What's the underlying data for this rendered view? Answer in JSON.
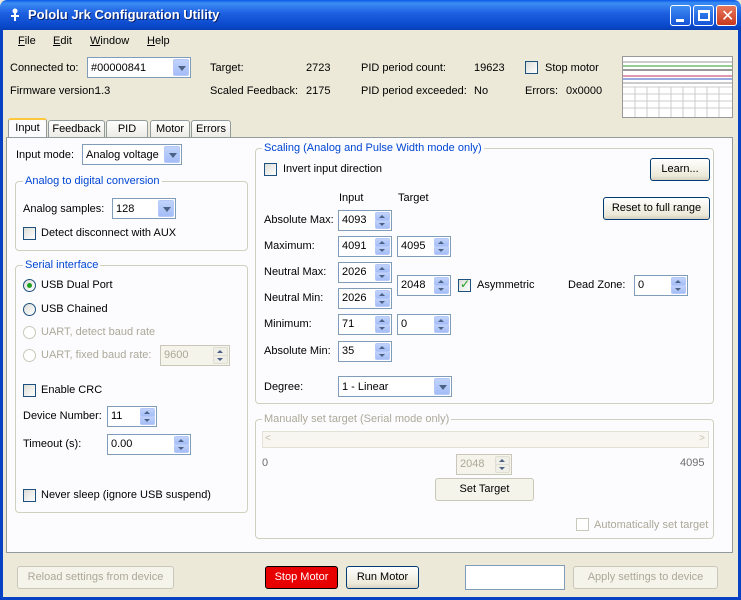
{
  "window": {
    "title": "Pololu Jrk Configuration Utility"
  },
  "menu": [
    {
      "label": "File",
      "key": "F",
      "rest": "ile"
    },
    {
      "label": "Edit",
      "key": "E",
      "rest": "dit"
    },
    {
      "label": "Window",
      "key": "W",
      "rest": "indow"
    },
    {
      "label": "Help",
      "key": "H",
      "rest": "elp"
    }
  ],
  "status": {
    "connected_label": "Connected to:",
    "device": "#00000841",
    "firmware_label": "Firmware version:",
    "firmware": "1.3",
    "target_label": "Target:",
    "target": "2723",
    "scaled_feedback_label": "Scaled Feedback:",
    "scaled_feedback": "2175",
    "pid_count_label": "PID period count:",
    "pid_count": "19623",
    "pid_exceeded_label": "PID period exceeded:",
    "pid_exceeded": "No",
    "stop_motor_label": "Stop motor",
    "errors_label": "Errors:",
    "errors": "0x0000"
  },
  "tabs": [
    "Input",
    "Feedback",
    "PID",
    "Motor",
    "Errors"
  ],
  "input": {
    "mode_label": "Input mode:",
    "mode_value": "Analog voltage",
    "adc_group": "Analog to digital conversion",
    "analog_samples_label": "Analog samples:",
    "analog_samples_value": "128",
    "detect_disconnect_label": "Detect disconnect with AUX",
    "serial_group": "Serial interface",
    "usb_dual": "USB Dual Port",
    "usb_chained": "USB Chained",
    "uart_detect": "UART, detect baud rate",
    "uart_fixed": "UART, fixed baud rate:",
    "baud_value": "9600",
    "enable_crc": "Enable CRC",
    "device_number_label": "Device Number:",
    "device_number": "11",
    "timeout_label": "Timeout (s):",
    "timeout": "0.00",
    "never_sleep": "Never sleep (ignore USB suspend)"
  },
  "scaling": {
    "group": "Scaling (Analog and Pulse Width mode only)",
    "invert_label": "Invert input direction",
    "learn_button": "Learn...",
    "reset_button": "Reset to full range",
    "input_header": "Input",
    "target_header": "Target",
    "abs_max_label": "Absolute Max:",
    "abs_max": "4093",
    "max_label": "Maximum:",
    "max_input": "4091",
    "max_target": "4095",
    "neutral_max_label": "Neutral Max:",
    "neutral_max": "2026",
    "neutral_target": "2048",
    "asymmetric_label": "Asymmetric",
    "dead_zone_label": "Dead Zone:",
    "dead_zone": "0",
    "neutral_min_label": "Neutral Min:",
    "neutral_min": "2026",
    "min_label": "Minimum:",
    "min_input": "71",
    "min_target": "0",
    "abs_min_label": "Absolute Min:",
    "abs_min": "35",
    "degree_label": "Degree:",
    "degree_value": "1 - Linear"
  },
  "manual": {
    "group": "Manually set target (Serial mode only)",
    "range_min": "0",
    "range_max": "4095",
    "value": "2048",
    "set_target_button": "Set Target",
    "auto_label": "Automatically set target"
  },
  "footer": {
    "reload": "Reload settings from device",
    "stop": "Stop Motor",
    "run": "Run Motor",
    "apply": "Apply settings to device"
  },
  "colors": {
    "stop_button": "#e80000",
    "group_title": "#0046d5",
    "title_bar": "#0a58e8"
  }
}
